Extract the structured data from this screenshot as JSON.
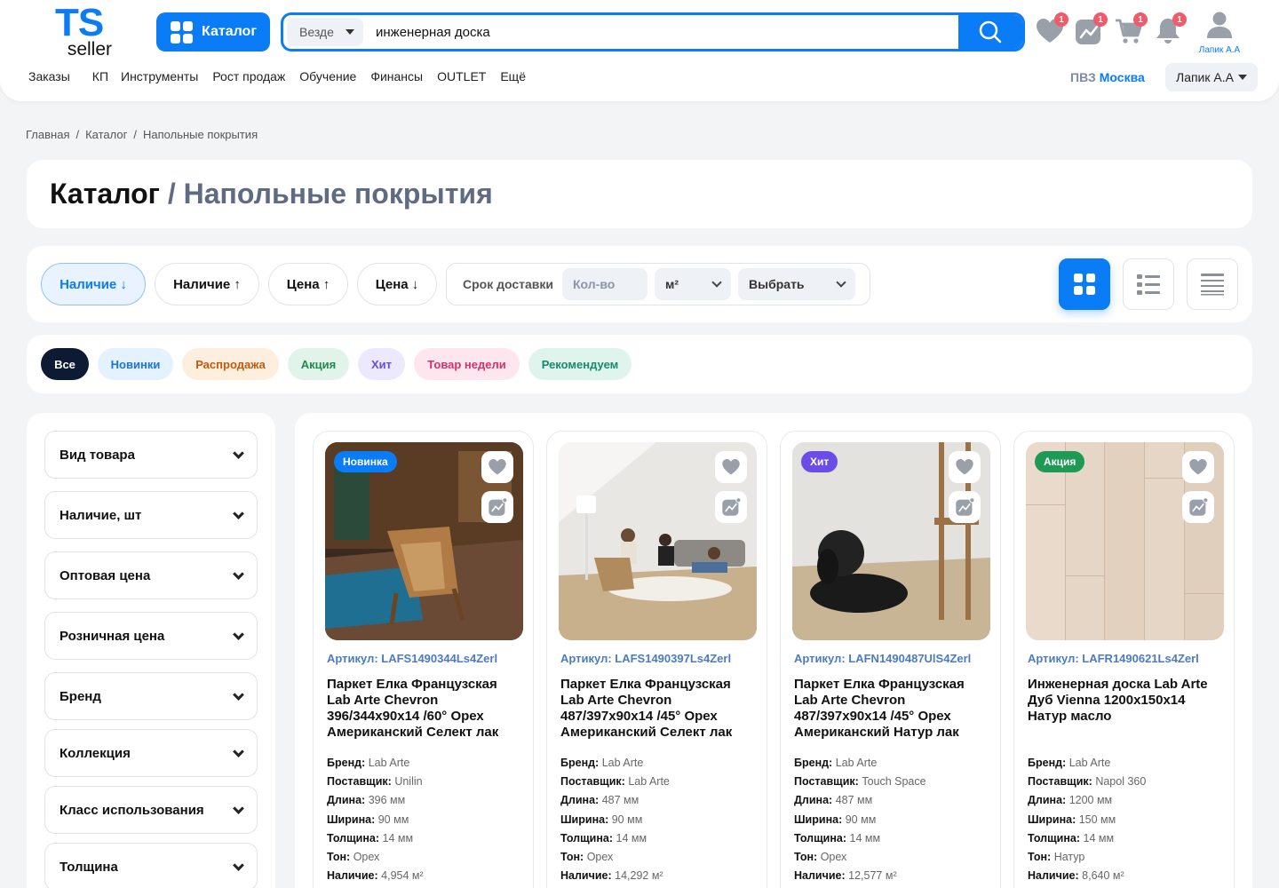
{
  "header": {
    "logo_top": "TS",
    "logo_bottom": "seller",
    "catalog_label": "Каталог",
    "search_scope": "Везде",
    "search_value": "инженерная доска",
    "badges": {
      "favorites": "1",
      "compare": "1",
      "cart": "1",
      "notifications": "1"
    },
    "user_name": "Лапик А.А",
    "nav": [
      "Заказы",
      "КП",
      "Инструменты",
      "Рост продаж",
      "Обучение",
      "Финансы",
      "OUTLET",
      "Ещё"
    ],
    "pvz_label": "ПВЗ",
    "pvz_city": "Москва",
    "account_label": "Лапик А.А"
  },
  "breadcrumb": [
    "Главная",
    "Каталог",
    "Напольные покрытия"
  ],
  "page_title": {
    "main": "Каталог",
    "sep": " / ",
    "sub": "Напольные покрытия"
  },
  "sort": {
    "pills": [
      "Наличие ↓",
      "Наличие ↑",
      "Цена ↑",
      "Цена ↓"
    ],
    "delivery_label": "Срок доставки",
    "qty_placeholder": "Кол-во",
    "unit": "м²",
    "choose": "Выбрать"
  },
  "tags": [
    {
      "label": "Все",
      "bg": "#0c1b33",
      "fg": "#ffffff"
    },
    {
      "label": "Новинки",
      "bg": "#e4f1fe",
      "fg": "#1a73e8"
    },
    {
      "label": "Распродажа",
      "bg": "#fdeedd",
      "fg": "#c15a0c"
    },
    {
      "label": "Акция",
      "bg": "#e2f4ea",
      "fg": "#1e8a4c"
    },
    {
      "label": "Хит",
      "bg": "#ece8fd",
      "fg": "#6a4ce6"
    },
    {
      "label": "Товар недели",
      "bg": "#fde6ee",
      "fg": "#d2336c"
    },
    {
      "label": "Рекомендуем",
      "bg": "#e0f4ee",
      "fg": "#178a6a"
    }
  ],
  "filters": [
    "Вид товара",
    "Наличие, шт",
    "Оптовая цена",
    "Розничная цена",
    "Бренд",
    "Коллекция",
    "Класс использования",
    "Толщина"
  ],
  "spec_labels": {
    "brand": "Бренд:",
    "supplier": "Поставщик:",
    "length": "Длина:",
    "width": "Ширина:",
    "thickness": "Толщина:",
    "tone": "Тон:",
    "stock": "Наличие:"
  },
  "products": [
    {
      "ribbon": "Новинка",
      "ribbon_color": "#0a7cf6",
      "sku": "Артикул: LAFS1490344Ls4Zerl",
      "name": "Паркет Елка Французская Lab Arte Chevron 396/344x90x14 /60° Орех Американский Селект лак",
      "brand": "Lab Arte",
      "supplier": "Unilin",
      "length": "396 мм",
      "width": "90 мм",
      "thickness": "14 мм",
      "tone": "Орех",
      "stock": "4,954 м²"
    },
    {
      "ribbon": "",
      "ribbon_color": "",
      "sku": "Артикул: LAFS1490397Ls4Zerl",
      "name": "Паркет Елка Французская Lab Arte Chevron 487/397x90x14 /45° Орех Американский Селект лак",
      "brand": "Lab Arte",
      "supplier": "Lab Arte",
      "length": "487 мм",
      "width": "90 мм",
      "thickness": "14 мм",
      "tone": "Орех",
      "stock": "14,292 м²"
    },
    {
      "ribbon": "Хит",
      "ribbon_color": "#6a4ce6",
      "sku": "Артикул: LAFN1490487UlS4Zerl",
      "name": "Паркет Елка Французская Lab Arte Chevron 487/397x90x14 /45° Орех Американский Натур лак",
      "brand": "Lab Arte",
      "supplier": "Touch Space",
      "length": "487 мм",
      "width": "90 мм",
      "thickness": "14 мм",
      "tone": "Орех",
      "stock": "12,577 м²"
    },
    {
      "ribbon": "Акция",
      "ribbon_color": "#1e9a54",
      "sku": "Артикул: LAFR1490621Ls4Zerl",
      "name": "Инженерная доска Lab Arte Дуб Vienna 1200x150x14 Натур масло",
      "brand": "Lab Arte",
      "supplier": "Napol 360",
      "length": "1200 мм",
      "width": "150 мм",
      "thickness": "14 мм",
      "tone": "Натур",
      "stock": "8,640 м²"
    }
  ]
}
